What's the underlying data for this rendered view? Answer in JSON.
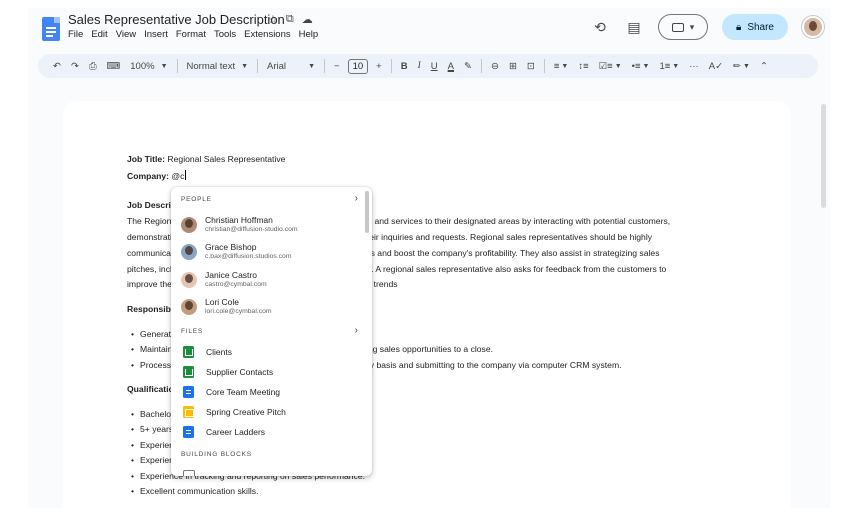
{
  "doc_title": "Sales Representative Job Description",
  "title_icons": [
    "star-icon",
    "move-to-folder-icon",
    "cloud-status-icon"
  ],
  "menu": [
    "File",
    "Edit",
    "View",
    "Insert",
    "Format",
    "Tools",
    "Extensions",
    "Help"
  ],
  "header": {
    "share_label": "Share"
  },
  "toolbar": {
    "zoom": "100%",
    "style": "Normal text",
    "font": "Arial",
    "font_size": "10",
    "minus": "−",
    "plus": "+",
    "bold": "B",
    "italic": "I",
    "underline": "U",
    "text_color": "A",
    "dots": "···"
  },
  "document": {
    "job_title_label": "Job Title:",
    "job_title_value": " Regional Sales Representative",
    "company_label": "Company:",
    "company_value": " @c",
    "job_desc_heading": "Job Description",
    "para_lines": [
      "The Regional Sales Representative promotes and sells products and services to their designated areas by interacting with potential customers,",
      "demonstrating the features of the products and responding to their inquiries and requests. Regional sales representatives should be highly",
      "communicative and have excellent skills to conduct product sales and boost the company's profitability. They also assist in strategizing sales",
      "pitches, including producing and distributing marketing materials. A regional sales representative also asks for feedback from the customers to",
      "improve the company's products and services for current market trends"
    ],
    "responsibilities_heading": "Responsibilities",
    "responsibilities": [
      "Generating leads and prospects.",
      "Maintaining relationships with customers and assist in bringing sales opportunities to a close.",
      "Processing orders, tracking inventory and accounts on a daily basis and submitting to the company via computer CRM system."
    ],
    "qualifications_heading": "Qualifications",
    "qualifications": [
      "Bachelor's degree in business or related field.",
      "5+ years of sales experience.",
      "Experience in B2B sales.",
      "Experience in developing and executing sales strategies.",
      "Experience in tracking and reporting on sales performance.",
      "Excellent communication skills."
    ]
  },
  "dropdown": {
    "people_header": "PEOPLE",
    "people": [
      {
        "name": "Christian Hoffman",
        "email": "christian@diffusion-studio.com",
        "color": "#b08a72"
      },
      {
        "name": "Grace Bishop",
        "email": "c.bax@diffusion.studios.com",
        "color": "#8aa4c4"
      },
      {
        "name": "Janice Castro",
        "email": "castro@cymbal.com",
        "color": "#6b4a3a"
      },
      {
        "name": "Lori Cole",
        "email": "lori.cole@cymbal.com",
        "color": "#c69c7e"
      }
    ],
    "files_header": "FILES",
    "files": [
      {
        "name": "Clients",
        "type": "sheet",
        "color": "#1e8e3e"
      },
      {
        "name": "Supplier Contacts",
        "type": "sheet",
        "color": "#1e8e3e"
      },
      {
        "name": "Core Team Meeting",
        "type": "doc",
        "color": "#1a73e8"
      },
      {
        "name": "Spring Creative Pitch",
        "type": "slide",
        "color": "#fbbc04"
      },
      {
        "name": "Career Ladders",
        "type": "doc",
        "color": "#1a73e8"
      }
    ],
    "blocks_header": "BUILDING BLOCKS"
  }
}
